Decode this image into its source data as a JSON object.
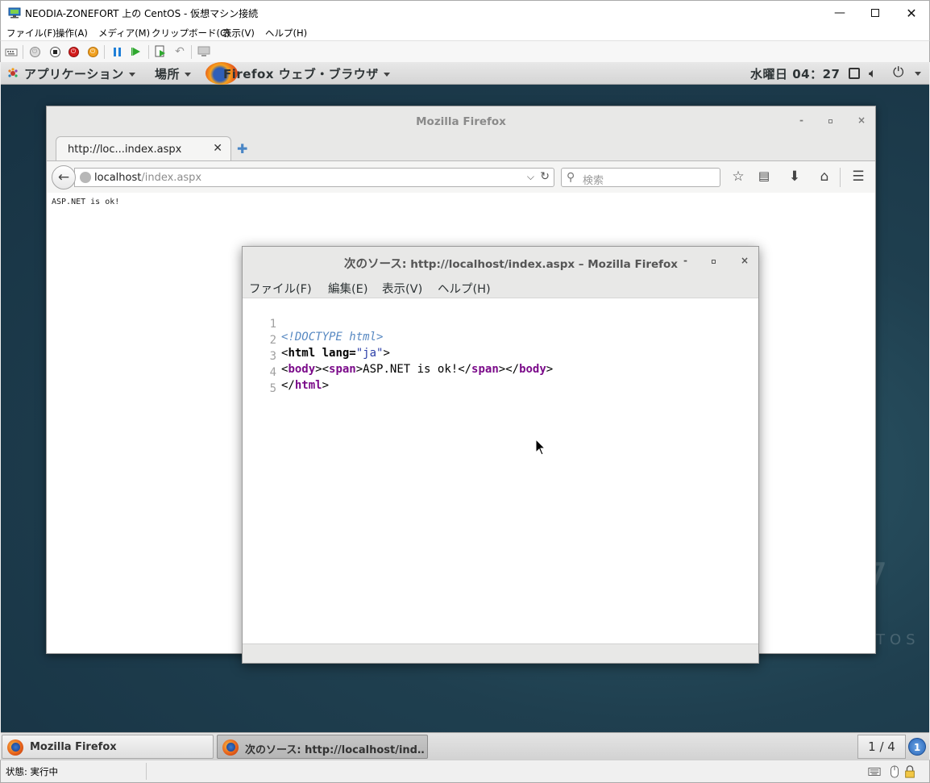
{
  "host": {
    "title": "NEODIA-ZONEFORT 上の CentOS - 仮想マシン接続",
    "menu": [
      "ファイル(F)",
      "操作(A)",
      "メディア(M)",
      "クリップボード(C)",
      "表示(V)",
      "ヘルプ(H)"
    ],
    "status": "状態: 実行中"
  },
  "gnome": {
    "applications": "アプリケーション",
    "places": "場所",
    "active_app": "Firefox ウェブ・ブラウザ",
    "clock": "水曜日 04：27"
  },
  "firefox": {
    "window_title": "Mozilla Firefox",
    "tab_label": "http://loc...index.aspx",
    "url_host": "localhost",
    "url_path": "/index.aspx",
    "search_placeholder": "検索",
    "page_text": "ASP.NET is ok!"
  },
  "view_source": {
    "title_prefix": "次のソース:",
    "title_url": "http://localhost/index.aspx – Mozilla Firefox",
    "menu": [
      "ファイル(F)",
      "編集(E)",
      "表示(V)",
      "ヘルプ(H)"
    ],
    "line_numbers": [
      "1",
      "2",
      "3",
      "4",
      "5"
    ],
    "code": {
      "line1": "<!DOCTYPE html>",
      "line2_open": "<",
      "line2_tag": "html",
      "line2_attr": " lang=",
      "line2_val": "\"ja\"",
      "line2_close": ">",
      "line3_body_open": "body",
      "line3_span_open": "span",
      "line3_text": "ASP.NET is ok!",
      "line3_span_close": "span",
      "line3_body_close": "body",
      "line4_tag": "html"
    }
  },
  "taskbar": {
    "task1": "Mozilla Firefox",
    "task2": "次のソース:  http://localhost/ind…",
    "workspace": "1 / 4",
    "notifications": "1"
  },
  "desktop": {
    "brand_number": "7",
    "brand_text": "TOS"
  }
}
